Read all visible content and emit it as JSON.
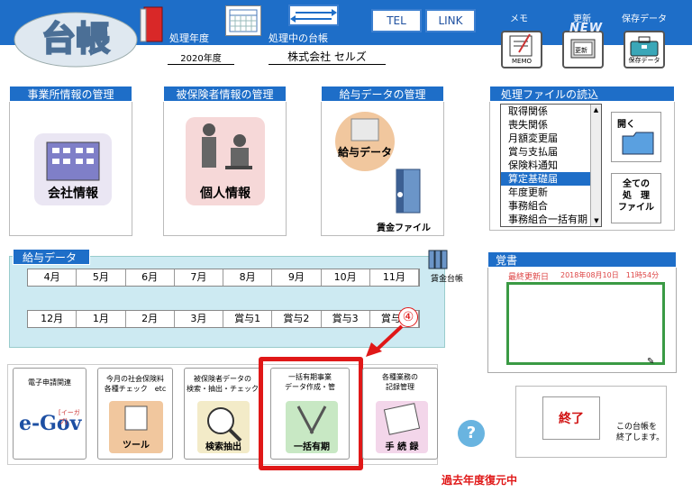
{
  "header": {
    "logo_text": "台帳",
    "year_label": "処理年度",
    "year_value": "2020年度",
    "processing_label": "処理中の台帳",
    "company_value": "株式会社 セルズ",
    "tel_label": "TEL",
    "link_label": "LINK",
    "memo_label": "メモ",
    "memo_icon_text": "MEMO",
    "update_label": "更新",
    "update_icon_text": "更新",
    "update_badge": "NEW",
    "save_label": "保存データ",
    "save_icon_text": "保存データ"
  },
  "panels": {
    "office": {
      "title": "事業所情報の管理",
      "button": "会社情報"
    },
    "insured": {
      "title": "被保険者情報の管理",
      "button": "個人情報"
    },
    "salary": {
      "title": "給与データの管理",
      "button": "給与データ",
      "ledger": "賃金ファイル"
    },
    "files": {
      "title": "処理ファイルの読込",
      "items": [
        "取得関係",
        "喪失関係",
        "月額変更届",
        "賞与支払届",
        "保険料通知",
        "算定基礎届",
        "年度更新",
        "事務組合",
        "事務組合一括有期"
      ],
      "selected_index": 5,
      "open_label": "開く",
      "all_files_label": [
        "全ての",
        "処　理",
        "ファイル"
      ]
    }
  },
  "salary_data": {
    "title": "給与データ",
    "ledger_label": "賃金台帳",
    "row1": [
      "4月",
      "5月",
      "6月",
      "7月",
      "8月",
      "9月",
      "10月",
      "11月"
    ],
    "row2": [
      "12月",
      "1月",
      "2月",
      "3月",
      "賞与1",
      "賞与2",
      "賞与3",
      "賞与4"
    ]
  },
  "notes": {
    "title": "覚書",
    "last_updated_label": "最終更新日",
    "last_updated_value": "2018年08月10日　11時54分"
  },
  "annotation": {
    "number": "④"
  },
  "bottom_buttons": [
    {
      "caption": [
        "電子申請関連"
      ],
      "icon_text": "e-Gov",
      "icon_sub": "[イーガブ]"
    },
    {
      "caption": [
        "今月の社会保険料",
        "各種チェック　etc"
      ],
      "icon_text": "ツール"
    },
    {
      "caption": [
        "被保険者データの",
        "検索・抽出・チェック"
      ],
      "icon_text": "検索抽出"
    },
    {
      "caption": [
        "一括有期事業",
        "データ作成・管"
      ],
      "icon_text": "一括有期"
    },
    {
      "caption": [
        "各種業務の",
        "記録管理"
      ],
      "icon_text": "手 続 録"
    }
  ],
  "help_label": "?",
  "exit": {
    "label": "終了",
    "note": [
      "この台帳を",
      "終了します。"
    ]
  },
  "status_text": "過去年度復元中",
  "colors": {
    "header_blue": "#1e6ec8",
    "highlight_red": "#e01818",
    "exit_red": "#d01010"
  }
}
